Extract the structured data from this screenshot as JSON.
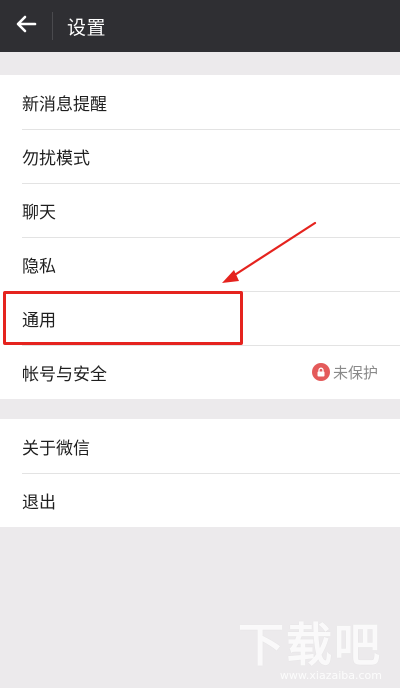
{
  "header": {
    "title": "设置",
    "back_icon": "arrow-left-icon",
    "background": "#2f2f33"
  },
  "group1": {
    "items": [
      {
        "label": "新消息提醒"
      },
      {
        "label": "勿扰模式"
      },
      {
        "label": "聊天"
      },
      {
        "label": "隐私"
      },
      {
        "label": "通用"
      },
      {
        "label": "帐号与安全",
        "badge": "未保护",
        "badge_icon": "lock-icon"
      }
    ]
  },
  "group2": {
    "items": [
      {
        "label": "关于微信"
      },
      {
        "label": "退出"
      }
    ]
  },
  "annotation": {
    "highlight_color": "#e5231e",
    "highlighted_item": "通用"
  },
  "watermark": {
    "text": "下载吧",
    "url": "www.xiazaiba.com"
  }
}
